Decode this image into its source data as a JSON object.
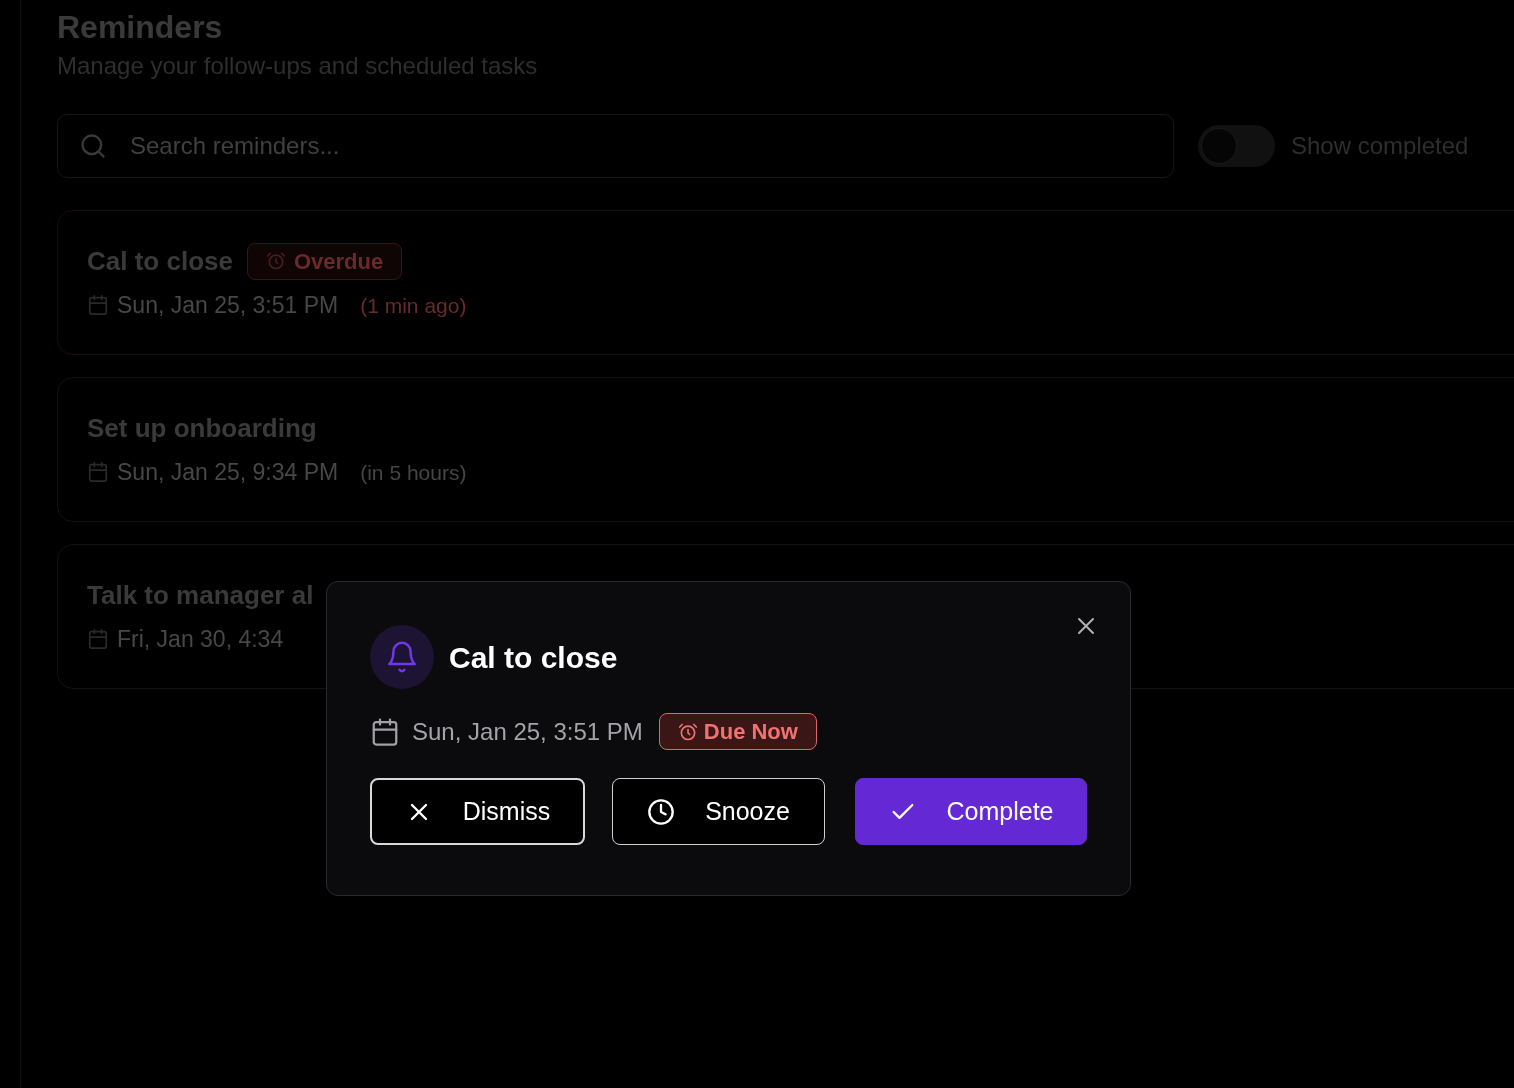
{
  "page": {
    "title": "Reminders",
    "subtitle": "Manage your follow-ups and scheduled tasks"
  },
  "search": {
    "placeholder": "Search reminders..."
  },
  "show_completed": {
    "label": "Show completed",
    "on": false
  },
  "reminders": [
    {
      "title": "Cal to close",
      "overdue": true,
      "badge": "Overdue",
      "date": "Sun, Jan 25, 3:51 PM",
      "relative": "(1 min ago)"
    },
    {
      "title": "Set up onboarding",
      "overdue": false,
      "date": "Sun, Jan 25, 9:34 PM",
      "relative": "(in 5 hours)"
    },
    {
      "title": "Talk to manager al",
      "overdue": false,
      "date": "Fri, Jan 30, 4:34"
    }
  ],
  "dialog": {
    "title": "Cal to close",
    "date": "Sun, Jan 25, 3:51 PM",
    "badge": "Due Now",
    "buttons": [
      {
        "kind": "dismiss",
        "label": "Dismiss",
        "focused": true
      },
      {
        "kind": "snooze",
        "label": "Snooze",
        "focused": false
      },
      {
        "kind": "complete",
        "label": "Complete",
        "focused": false
      }
    ]
  }
}
